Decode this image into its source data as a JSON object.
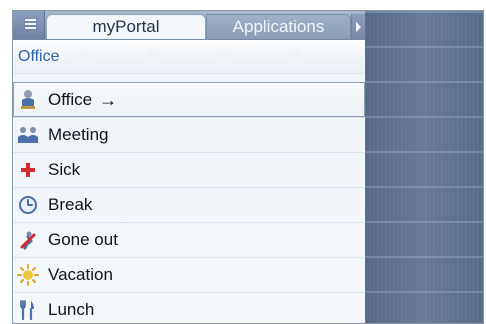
{
  "app": {
    "tabs": [
      {
        "label": "myPortal"
      },
      {
        "label": "Applications"
      }
    ],
    "section_title": "Office",
    "items": [
      {
        "label": "Office",
        "icon": "office-person-icon",
        "selected": true,
        "suffix": "→"
      },
      {
        "label": "Meeting",
        "icon": "meeting-people-icon"
      },
      {
        "label": "Sick",
        "icon": "red-cross-icon"
      },
      {
        "label": "Break",
        "icon": "clock-icon"
      },
      {
        "label": "Gone out",
        "icon": "gone-out-icon"
      },
      {
        "label": "Vacation",
        "icon": "sun-icon"
      },
      {
        "label": "Lunch",
        "icon": "cutlery-icon"
      }
    ]
  },
  "theme": {
    "accent": "#2f65a6",
    "tab_active": "#f4f7fb",
    "tab_inactive": "#8a9db8",
    "panel_background": "#eef3f8",
    "sidebar_background": "#5a6e8d",
    "selected_outline": "#8e9fb6",
    "red": "#d52b2b",
    "sun": "#f0c63a"
  }
}
